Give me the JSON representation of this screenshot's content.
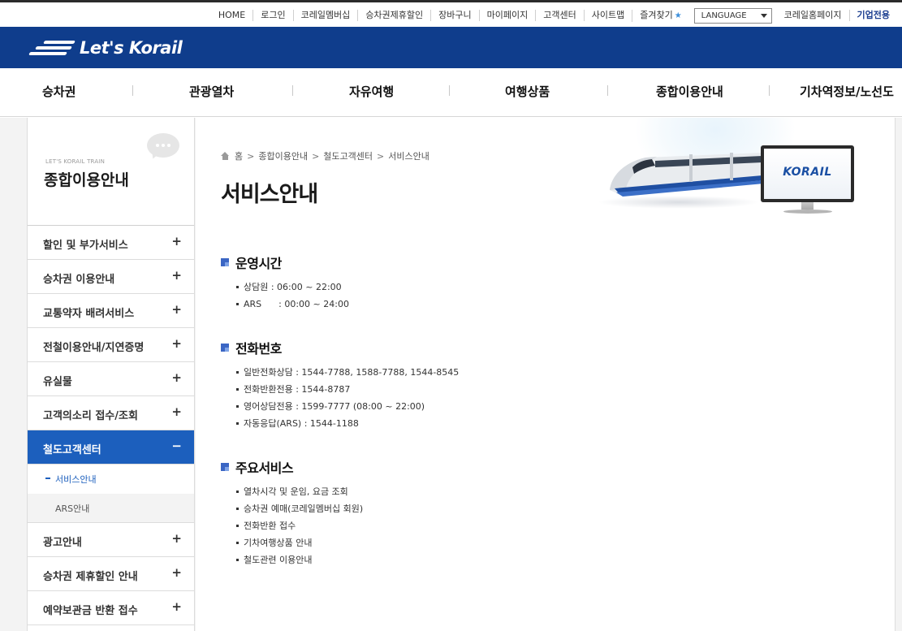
{
  "top_links": [
    "HOME",
    "로그인",
    "코레일멤버십",
    "승차권제휴할인",
    "장바구니",
    "마이페이지",
    "고객센터",
    "사이트맵",
    "즐겨찾기"
  ],
  "language_label": "LANGUAGE",
  "homepage_link": "코레일홈페이지",
  "corporate_link": "기업전용",
  "logo_text": "Let's Korail",
  "main_nav": [
    "승차권",
    "관광열차",
    "자유여행",
    "여행상품",
    "종합이용안내",
    "기차역정보/노선도"
  ],
  "sidebar": {
    "subtitle": "LET'S KORAIL TRAIN",
    "title": "종합이용안내",
    "items": [
      {
        "label": "할인 및 부가서비스",
        "sign": "+"
      },
      {
        "label": "승차권 이용안내",
        "sign": "+"
      },
      {
        "label": "교통약자 배려서비스",
        "sign": "+"
      },
      {
        "label": "전철이용안내/지연증명",
        "sign": "+"
      },
      {
        "label": "유실물",
        "sign": "+"
      },
      {
        "label": "고객의소리 접수/조회",
        "sign": "+"
      },
      {
        "label": "철도고객센터",
        "sign": "−"
      },
      {
        "label": "광고안내",
        "sign": "+"
      },
      {
        "label": "승차권 제휴할인 안내",
        "sign": "+"
      },
      {
        "label": "예약보관금 반환 접수",
        "sign": "+"
      }
    ],
    "subitems": [
      "서비스안내",
      "ARS안내"
    ]
  },
  "breadcrumb": [
    "홈",
    "종합이용안내",
    "철도고객센터",
    "서비스안내"
  ],
  "page_title": "서비스안내",
  "banner_brand": "KORAIL",
  "sections": [
    {
      "title": "운영시간",
      "items": [
        "상담원 : 06:00 ~ 22:00",
        "ARS      : 00:00 ~ 24:00"
      ]
    },
    {
      "title": "전화번호",
      "items": [
        "일반전화상담 : 1544-7788, 1588-7788, 1544-8545",
        "전화반환전용 : 1544-8787",
        "영어상담전용 : 1599-7777 (08:00 ~ 22:00)",
        "자동응답(ARS) : 1544-1188"
      ]
    },
    {
      "title": "주요서비스",
      "items": [
        "열차시각 및 운임, 요금 조회",
        "승차권 예매(코레일멤버십 회원)",
        "전화반환 접수",
        "기차여행상품 안내",
        "철도관련 이용안내"
      ]
    }
  ],
  "colors": {
    "brand_blue": "#0f3d8c",
    "active_blue": "#1c5fbd",
    "bullet_blue": "#3b66c4"
  }
}
